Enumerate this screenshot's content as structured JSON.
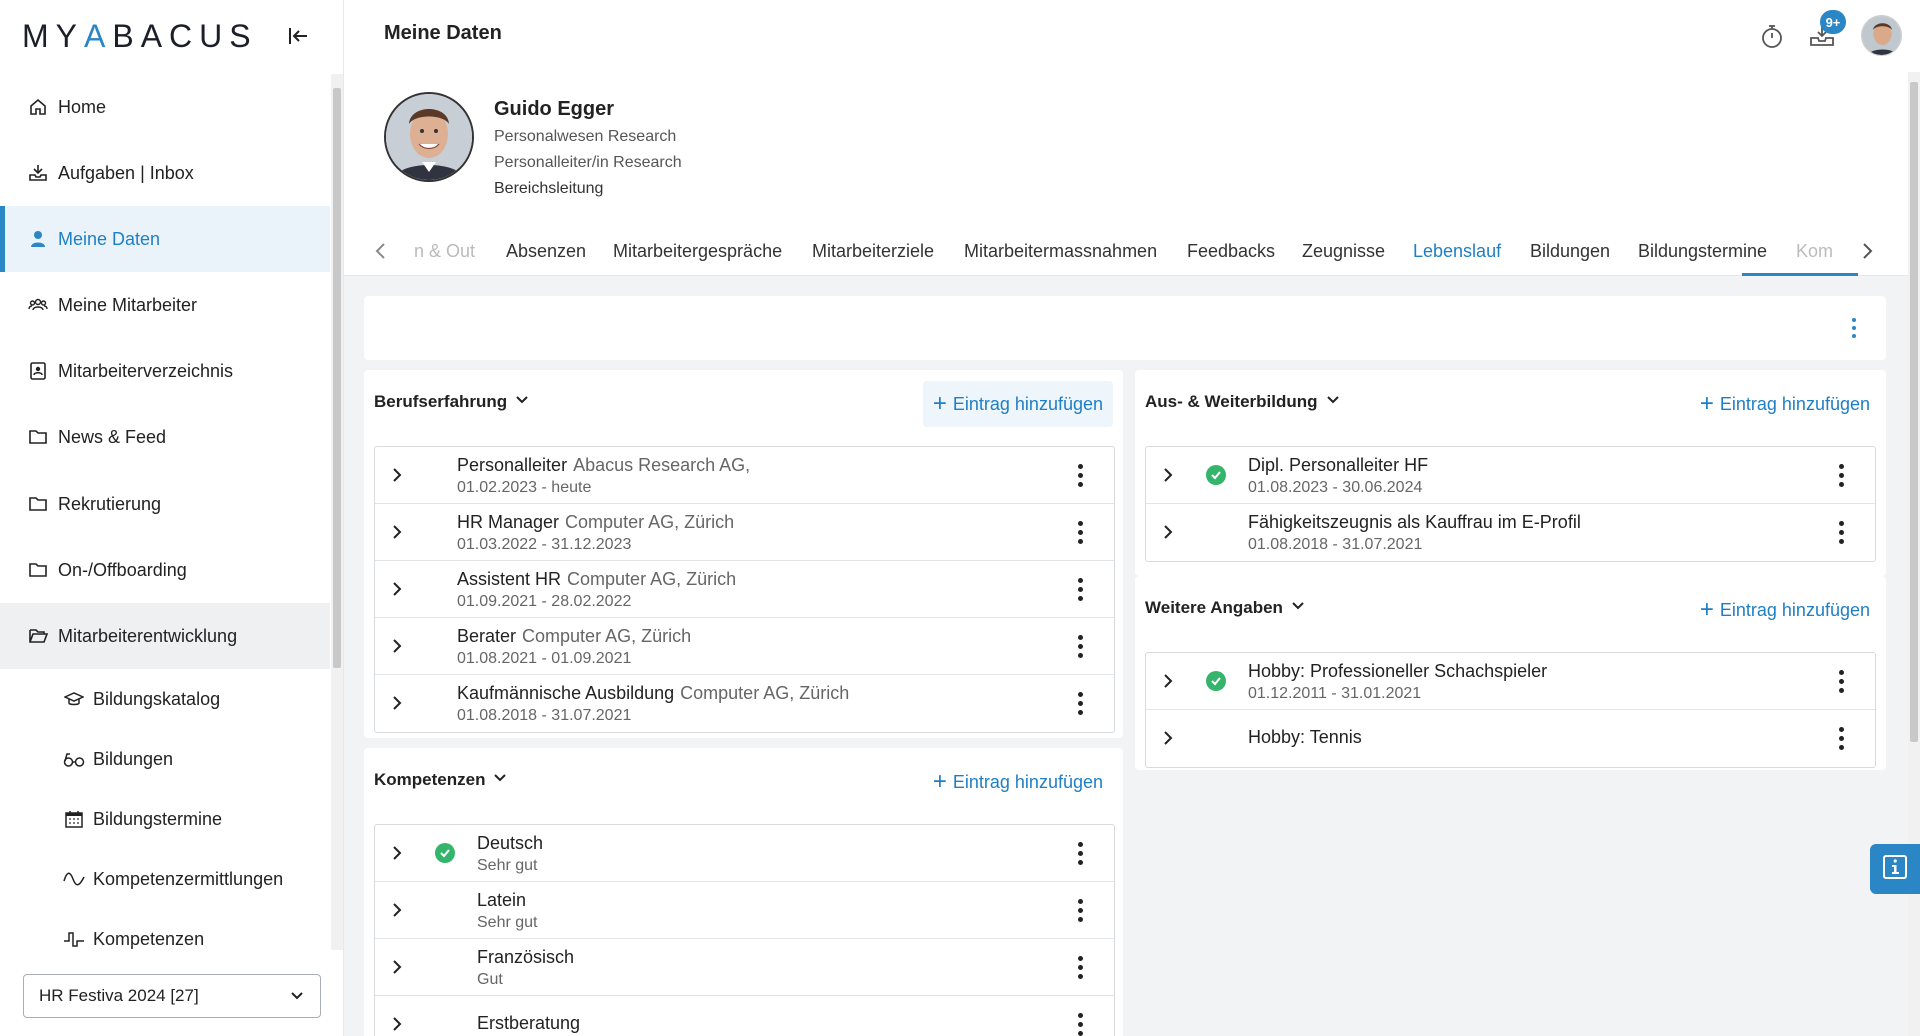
{
  "app": {
    "logo_text": "MYABACUS"
  },
  "sidebar": {
    "items": [
      {
        "label": "Home",
        "icon": "home-icon"
      },
      {
        "label": "Aufgaben | Inbox",
        "icon": "inbox-icon"
      },
      {
        "label": "Meine Daten",
        "icon": "person-icon"
      },
      {
        "label": "Meine Mitarbeiter",
        "icon": "people-icon"
      },
      {
        "label": "Mitarbeiterverzeichnis",
        "icon": "contact-book-icon"
      },
      {
        "label": "News & Feed",
        "icon": "folder-icon"
      },
      {
        "label": "Rekrutierung",
        "icon": "folder-icon"
      },
      {
        "label": "On-/Offboarding",
        "icon": "folder-icon"
      },
      {
        "label": "Mitarbeiterentwicklung",
        "icon": "folder-open-icon"
      }
    ],
    "sub_items": [
      {
        "label": "Bildungskatalog",
        "icon": "graduation-cap-icon"
      },
      {
        "label": "Bildungen",
        "icon": "glasses-icon"
      },
      {
        "label": "Bildungstermine",
        "icon": "calendar-icon"
      },
      {
        "label": "Kompetenzermittlungen",
        "icon": "wave-icon"
      },
      {
        "label": "Kompetenzen",
        "icon": "step-icon"
      }
    ],
    "mandant": "HR Festiva 2024 [27]"
  },
  "header": {
    "title": "Meine Daten",
    "inbox_badge": "9+"
  },
  "profile": {
    "name": "Guido Egger",
    "line1": "Personalwesen Research",
    "line2": "Personalleiter/in Research",
    "line3": "Bereichsleitung"
  },
  "tabs": [
    {
      "label": "n & Out"
    },
    {
      "label": "Absenzen"
    },
    {
      "label": "Mitarbeitergespräche"
    },
    {
      "label": "Mitarbeiterziele"
    },
    {
      "label": "Mitarbeitermassnahmen"
    },
    {
      "label": "Feedbacks"
    },
    {
      "label": "Zeugnisse"
    },
    {
      "label": "Lebenslauf"
    },
    {
      "label": "Bildungen"
    },
    {
      "label": "Bildungstermine"
    },
    {
      "label": "Kom"
    }
  ],
  "add_label": "Eintrag hinzufügen",
  "berufserfahrung": {
    "title": "Berufserfahrung",
    "rows": [
      {
        "title": "Personalleiter",
        "company": "Abacus Research AG,",
        "dates": "01.02.2023 - heute"
      },
      {
        "title": "HR Manager",
        "company": "Computer AG, Zürich",
        "dates": "01.03.2022 - 31.12.2023"
      },
      {
        "title": "Assistent HR",
        "company": "Computer AG, Zürich",
        "dates": "01.09.2021 - 28.02.2022"
      },
      {
        "title": "Berater",
        "company": "Computer AG, Zürich",
        "dates": "01.08.2021 - 01.09.2021"
      },
      {
        "title": "Kaufmännische Ausbildung",
        "company": "Computer AG, Zürich",
        "dates": "01.08.2018 - 31.07.2021"
      }
    ]
  },
  "kompetenzen": {
    "title": "Kompetenzen",
    "rows": [
      {
        "title": "Deutsch",
        "level": "Sehr gut"
      },
      {
        "title": "Latein",
        "level": "Sehr gut"
      },
      {
        "title": "Französisch",
        "level": "Gut"
      },
      {
        "title": "Erstberatung",
        "level": ""
      }
    ]
  },
  "weiterbildung": {
    "title": "Aus- & Weiterbildung",
    "rows": [
      {
        "title": "Dipl. Personalleiter HF",
        "dates": "01.08.2023 - 30.06.2024"
      },
      {
        "title": "Fähigkeitszeugnis als Kauffrau im E-Profil",
        "dates": "01.08.2018 - 31.07.2021"
      }
    ]
  },
  "weitere": {
    "title": "Weitere Angaben",
    "rows": [
      {
        "title": "Hobby: Professioneller Schachspieler",
        "dates": "01.12.2011 - 31.01.2021"
      },
      {
        "title": "Hobby: Tennis",
        "dates": ""
      }
    ]
  },
  "colors": {
    "accent": "#2b86c5",
    "check": "#35b56c"
  }
}
